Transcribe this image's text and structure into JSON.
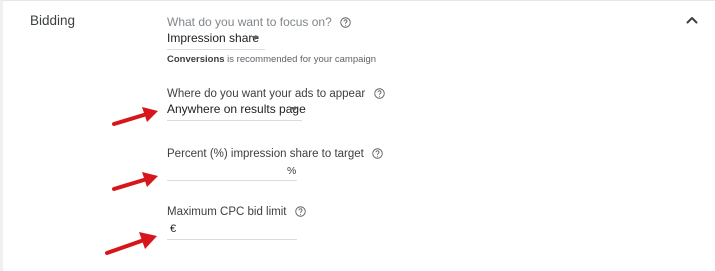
{
  "section": {
    "title": "Bidding",
    "collapse_icon": "chevron-up-icon"
  },
  "focus": {
    "label": "What do you want to focus on?",
    "value": "Impression share",
    "hint_bold": "Conversions",
    "hint_rest": " is recommended for your campaign"
  },
  "location": {
    "label": "Where do you want your ads to appear",
    "value": "Anywhere on results page"
  },
  "percent": {
    "label": "Percent (%) impression share to target",
    "value": "",
    "suffix": "%"
  },
  "max_cpc": {
    "label": "Maximum CPC bid limit",
    "value": "",
    "prefix": "€"
  },
  "colors": {
    "annotation_arrow": "#d7161b",
    "help_icon": "#5f6368"
  }
}
